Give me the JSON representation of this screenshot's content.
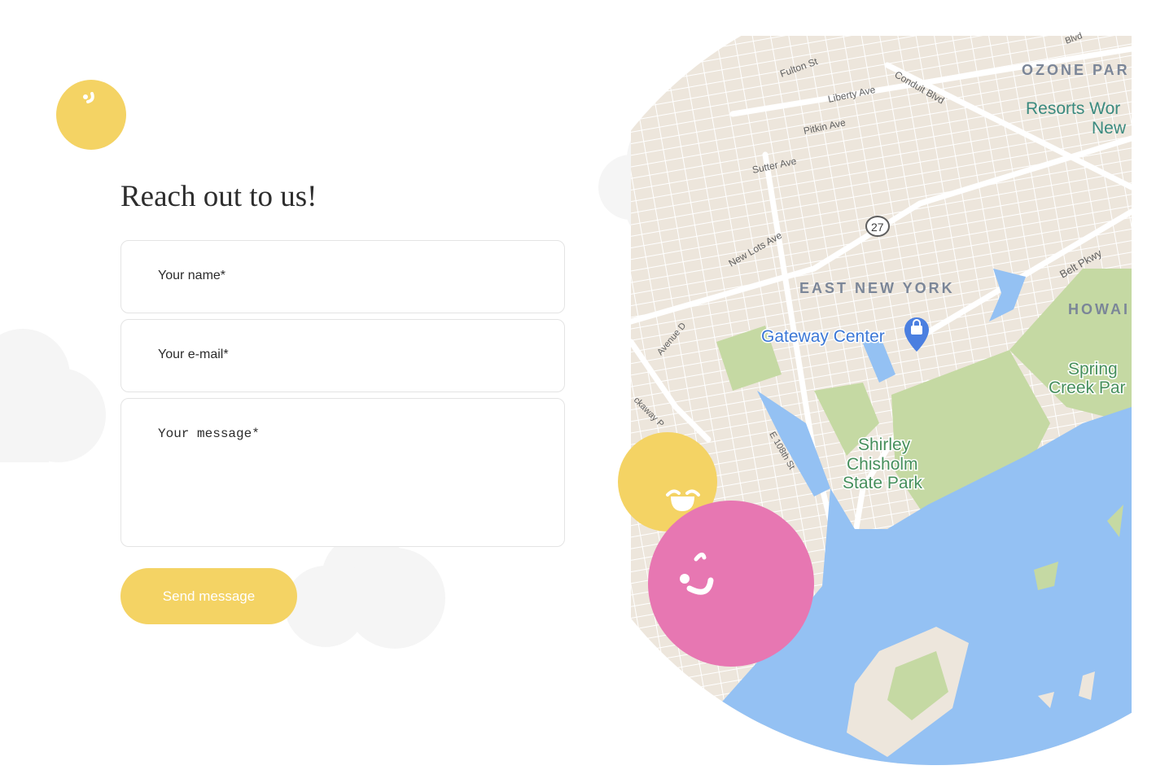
{
  "form": {
    "title": "Reach out to us!",
    "name_placeholder": "Your name*",
    "email_placeholder": "Your e-mail*",
    "message_placeholder": "Your message*",
    "send_label": "Send message"
  },
  "map": {
    "labels": {
      "fulton": "Fulton St",
      "blvd": "Blvd",
      "liberty": "Liberty Ave",
      "conduit": "Conduit Blvd",
      "pitkin": "Pitkin Ave",
      "sutter": "Sutter Ave",
      "route": "27",
      "new_lots": "New Lots Ave",
      "belt": "Belt Pkwy",
      "ozone": "OZONE PAR",
      "resorts1": "Resorts Wor",
      "resorts2": "New",
      "east_ny": "EAST NEW YORK",
      "howard": "HOWAI",
      "gateway": "Gateway Center",
      "avenue_d": "Avenue D",
      "rockaway": "ckaway P",
      "e108": "E 108th St",
      "spring1": "Spring",
      "spring2": "Creek Par",
      "shirley1": "Shirley",
      "shirley2": "Chisholm",
      "shirley3": "State Park"
    }
  },
  "colors": {
    "yellow": "#f4d364",
    "pink": "#e777b2",
    "water": "#94c1f3",
    "land": "#ede6dc",
    "park": "#c5d9a3",
    "cloud": "#f4f4f4"
  }
}
